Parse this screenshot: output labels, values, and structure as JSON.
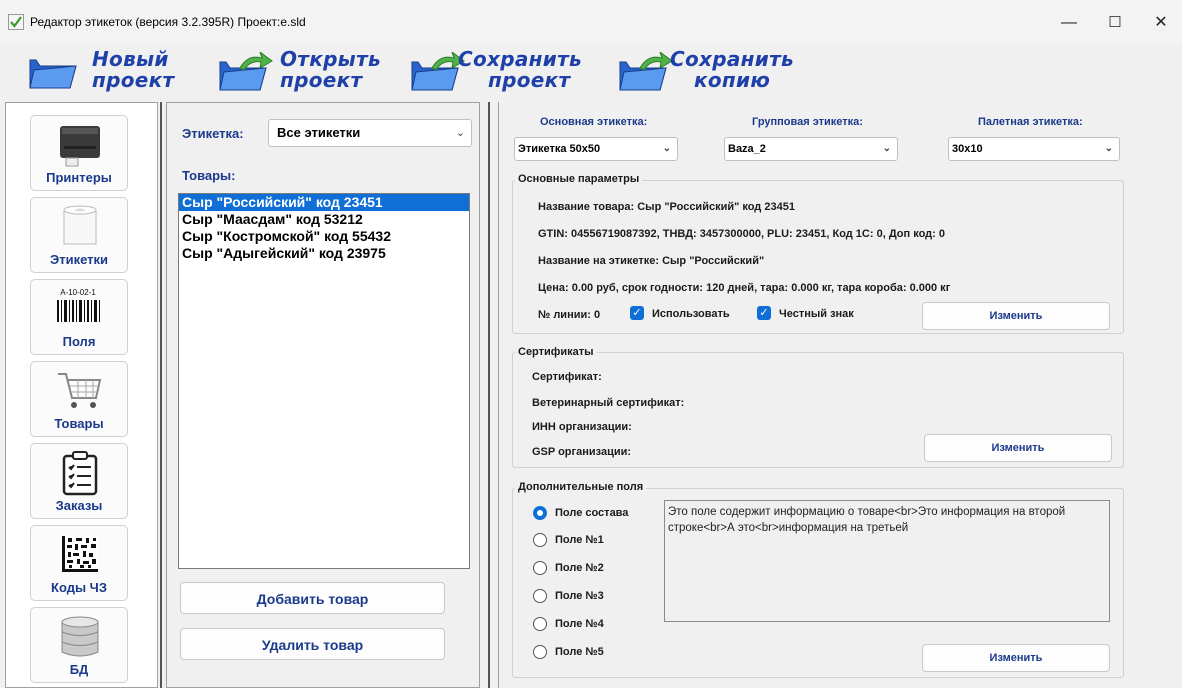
{
  "window": {
    "title": "Редактор этикеток (версия 3.2.395R) Проект:e.sld",
    "minimize_glyph": "—",
    "maximize_glyph": "☐",
    "close_glyph": "✕"
  },
  "toolbar": {
    "new_project": [
      "Новый",
      "проект"
    ],
    "open_project": [
      "Открыть",
      "проект"
    ],
    "save_project": [
      "Сохранить",
      "проект"
    ],
    "save_copy": [
      "Сохранить",
      "копию"
    ]
  },
  "sidebar": {
    "items": [
      {
        "label": "Принтеры",
        "icon": "printer-icon"
      },
      {
        "label": "Этикетки",
        "icon": "label-roll-icon"
      },
      {
        "label": "Поля",
        "icon": "barcode-icon",
        "caption": "A-10-02-1"
      },
      {
        "label": "Товары",
        "icon": "shopping-cart-icon"
      },
      {
        "label": "Заказы",
        "icon": "clipboard-icon"
      },
      {
        "label": "Коды ЧЗ",
        "icon": "datamatrix-icon"
      },
      {
        "label": "БД",
        "icon": "database-icon"
      }
    ]
  },
  "products_panel": {
    "label_filter_caption": "Этикетка:",
    "label_filter_value": "Все этикетки",
    "products_caption": "Товары:",
    "products": [
      "Сыр \"Российский\" код 23451",
      "Сыр \"Маасдам\" код 53212",
      "Сыр \"Костромской\" код 55432",
      "Сыр \"Адыгейский\" код 23975"
    ],
    "selected_index": 0,
    "add_button": "Добавить товар",
    "delete_button": "Удалить товар"
  },
  "labels": {
    "main_caption": "Основная этикетка:",
    "main_value": "Этикетка 50x50",
    "group_caption": "Групповая этикетка:",
    "group_value": "Baza_2",
    "pallet_caption": "Палетная этикетка:",
    "pallet_value": "30x10"
  },
  "main_params": {
    "title": "Основные параметры",
    "product_name": "Название товара: Сыр \"Российский\" код 23451",
    "codes": "GTIN: 04556719087392, ТНВД: 3457300000, PLU: 23451, Код 1С: 0, Доп код: 0",
    "label_name": "Название на этикетке: Сыр \"Российский\"",
    "price": "Цена: 0.00 руб, срок годности: 120 дней, тара: 0.000 кг, тара короба: 0.000 кг",
    "line_no": "№ линии: 0",
    "use_checkbox": "Использовать",
    "use_checked": true,
    "honest_sign_checkbox": "Честный знак",
    "honest_sign_checked": true,
    "edit_button": "Изменить"
  },
  "certificates": {
    "title": "Сертификаты",
    "certificate": "Сертификат:",
    "vet_certificate": "Ветеринарный сертификат:",
    "inn": "ИНН организации:",
    "gsp": "GSP организации:",
    "edit_button": "Изменить"
  },
  "extra_fields": {
    "title": "Дополнительные поля",
    "options": [
      "Поле состава",
      "Поле №1",
      "Поле №2",
      "Поле №3",
      "Поле №4",
      "Поле №5"
    ],
    "selected_index": 0,
    "text": "Это поле содержит информацию о товаре<br>Это информация на второй строке<br>А это<br>информация на третьей",
    "edit_button": "Изменить"
  },
  "colors": {
    "accent": "#0f6fd6",
    "toolbar_text": "#1e40a8",
    "label_text": "#1b3a8c"
  }
}
